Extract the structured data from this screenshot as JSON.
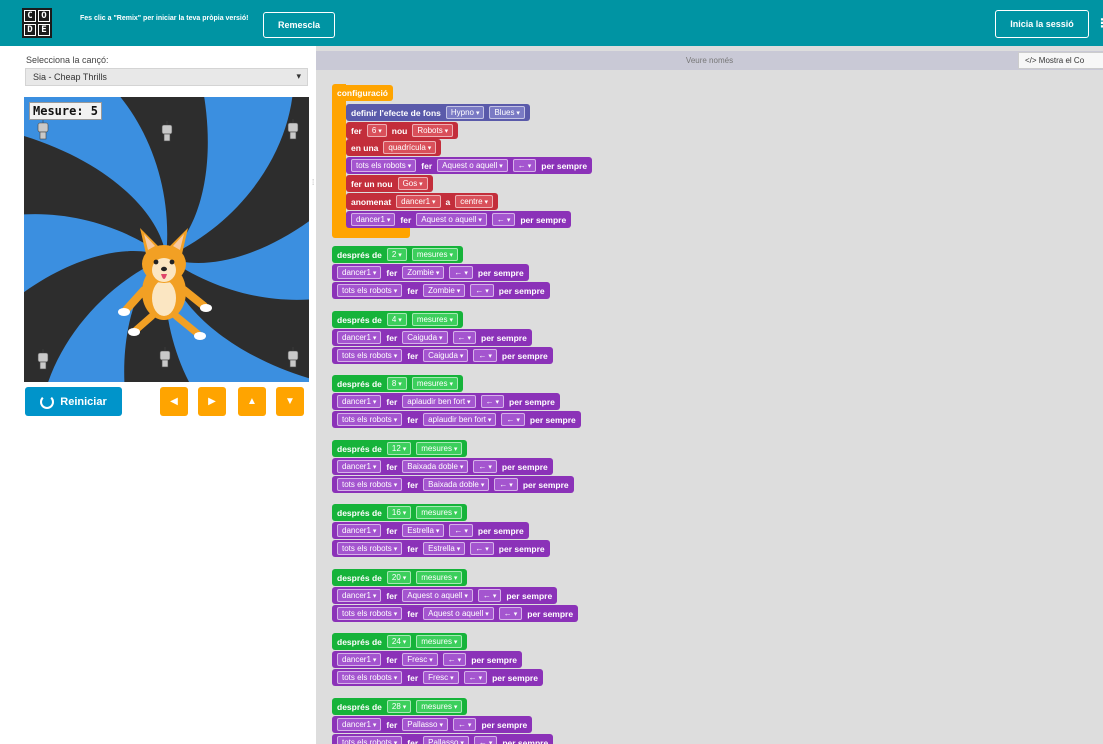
{
  "header": {
    "logo_letters": [
      "C",
      "O",
      "D",
      "E"
    ],
    "message": "Fes clic a \"Remix\" per iniciar la teva pròpia versió!",
    "remix_label": "Remescla",
    "signin_label": "Inicia la sessió",
    "more_label": "⋮"
  },
  "left": {
    "song_label": "Selecciona la cançó:",
    "song_value": "Sia - Cheap Thrills",
    "measure": "Mesure: 5",
    "reset_label": "Reiniciar",
    "arrows": [
      "◀",
      "▶",
      "▲",
      "▼"
    ]
  },
  "workspace": {
    "readonly": "Veure només",
    "show_code": "</> Mostra el Co"
  },
  "setup": {
    "title": "configuració",
    "bg_label": "definir l'efecte de fons",
    "bg_effect": "Hypno",
    "bg_palette": "Blues",
    "make": "fer",
    "make_count": "6",
    "new": "nou",
    "robots": "Robots",
    "in_a": "en una",
    "grid": "quadrícula",
    "all_robots": "tots els robots",
    "do": "fer",
    "move1": "Aquest o aquell",
    "dir": "←",
    "forever": "per sempre",
    "make_new": "fer un nou",
    "dog": "Gos",
    "named": "anomenat",
    "dancer": "dancer1",
    "at": "a",
    "center": "centre"
  },
  "events": [
    {
      "after": "després de",
      "n": "2",
      "unit": "mesures",
      "move": "Zombie"
    },
    {
      "after": "després de",
      "n": "4",
      "unit": "mesures",
      "move": "Caiguda"
    },
    {
      "after": "després de",
      "n": "8",
      "unit": "mesures",
      "move": "aplaudir ben fort"
    },
    {
      "after": "després de",
      "n": "12",
      "unit": "mesures",
      "move": "Baixada doble"
    },
    {
      "after": "després de",
      "n": "16",
      "unit": "mesures",
      "move": "Estrella"
    },
    {
      "after": "després de",
      "n": "20",
      "unit": "mesures",
      "move": "Aquest o aquell"
    },
    {
      "after": "després de",
      "n": "24",
      "unit": "mesures",
      "move": "Fresc"
    },
    {
      "after": "després de",
      "n": "28",
      "unit": "mesures",
      "move": "Pallasso"
    }
  ],
  "colors": {
    "header": "#0094a3",
    "event": "#16b33a",
    "action": "#8b32b8",
    "setup": "#ffa400",
    "sprite": "#c32e3b",
    "background": "#5a5aaa"
  }
}
